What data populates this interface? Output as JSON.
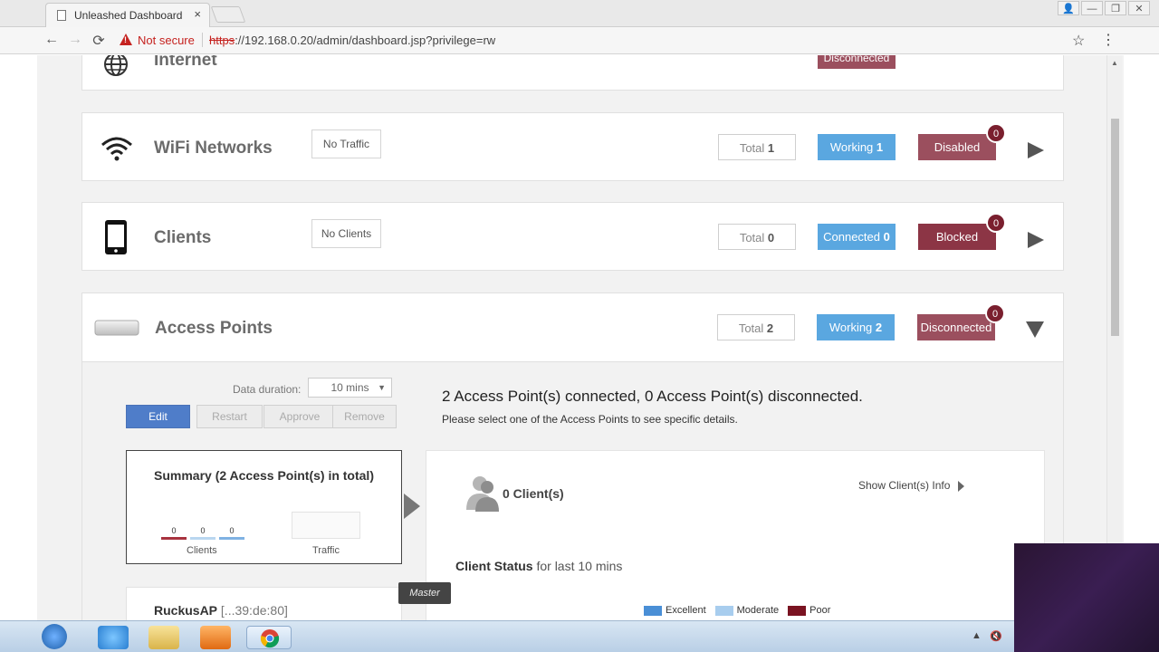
{
  "browser": {
    "tab_title": "Unleashed Dashboard",
    "tab_close": "×",
    "not_secure": "Not secure",
    "url_scheme": "https",
    "url_rest": "://192.168.0.20/admin/dashboard.jsp?privilege=rw",
    "back": "←",
    "forward": "→",
    "reload": "⟳",
    "star": "☆",
    "menu": "⋮",
    "win_buttons": [
      "👤",
      "—",
      "❐",
      "✕"
    ]
  },
  "internet_panel": {
    "name": "Internet",
    "status": "Disconnected"
  },
  "wifi_panel": {
    "name": "WiFi Networks",
    "traffic": "No Traffic",
    "total_label": "Total",
    "total_value": "1",
    "working_label": "Working",
    "working_value": "1",
    "disabled_label": "Disabled",
    "counter": "0"
  },
  "clients_panel": {
    "name": "Clients",
    "traffic": "No Clients",
    "total_label": "Total",
    "total_value": "0",
    "connected_label": "Connected",
    "connected_value": "0",
    "blocked_label": "Blocked",
    "counter": "0"
  },
  "ap_panel": {
    "name": "Access Points",
    "total_label": "Total",
    "total_value": "2",
    "working_label": "Working",
    "working_value": "2",
    "disconnected_label": "Disconnected",
    "counter": "0",
    "duration_label": "Data duration:",
    "duration_value": "10 mins",
    "buttons": {
      "edit": "Edit",
      "restart": "Restart",
      "approve": "Approve",
      "remove": "Remove"
    },
    "message": "2 Access Point(s) connected, 0 Access Point(s) disconnected.",
    "sub_message": "Please select one of the Access Points to see specific details.",
    "summary": {
      "title": "Summary (2 Access Point(s) in total)",
      "mini_values": [
        "0",
        "0",
        "0"
      ],
      "clients_label": "Clients",
      "traffic_label": "Traffic"
    },
    "client_detail": {
      "count": "0 Client(s)",
      "show_info": "Show Client(s) Info",
      "status_bold": "Client Status",
      "status_rest": " for last 10 mins",
      "legend": [
        {
          "label": "Excellent",
          "color": "#4a8fd6"
        },
        {
          "label": "Moderate",
          "color": "#a8cdee"
        },
        {
          "label": "Poor",
          "color": "#7a1321"
        }
      ]
    },
    "master_badge": "Master",
    "ap_name": "RuckusAP",
    "ap_mac": " [...39:de:80]"
  }
}
